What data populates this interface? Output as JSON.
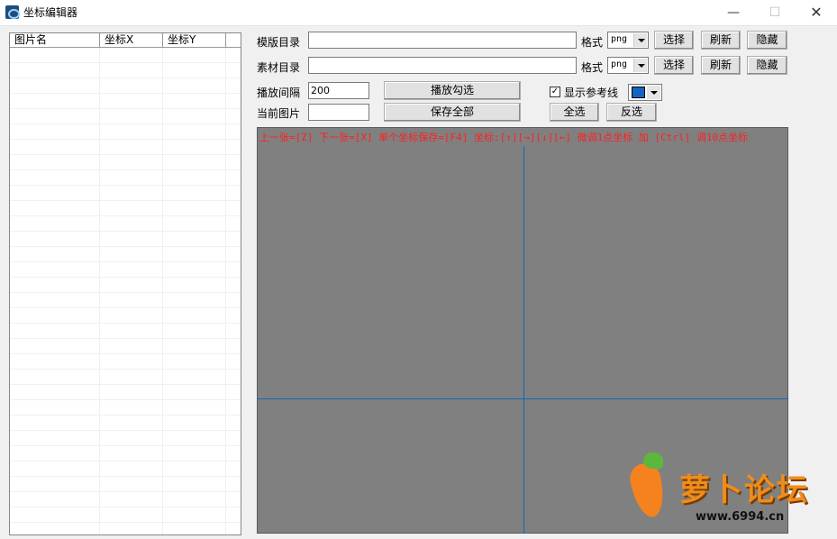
{
  "window": {
    "title": "坐标编辑器",
    "minimize_glyph": "—",
    "maximize_glyph": "☐",
    "close_glyph": "✕"
  },
  "list": {
    "columns": [
      "图片名",
      "坐标X",
      "坐标Y"
    ]
  },
  "template_dir": {
    "label": "模版目录",
    "value": "",
    "format_label": "格式",
    "format_value": "png",
    "select_label": "选择",
    "refresh_label": "刷新",
    "hide_label": "隐藏"
  },
  "material_dir": {
    "label": "素材目录",
    "value": "",
    "format_label": "格式",
    "format_value": "png",
    "select_label": "选择",
    "refresh_label": "刷新",
    "hide_label": "隐藏"
  },
  "playback": {
    "interval_label": "播放间隔",
    "interval_value": "200",
    "play_checked_label": "播放勾选",
    "current_image_label": "当前图片",
    "current_image_value": "",
    "save_all_label": "保存全部"
  },
  "reference": {
    "show_lines_label": "显示参考线",
    "show_lines_checked": true,
    "check_glyph": "✓",
    "line_color": "#1565c0",
    "select_all_label": "全选",
    "invert_label": "反选"
  },
  "canvas": {
    "hint": "上一张=[Z] 下一张=[X] 单个坐标保存=[F4] 坐标:[↑][→][↓][←] 微调1点坐标 加 [Ctrl] 调10点坐标",
    "background": "#808080",
    "hint_color": "#ff2020"
  },
  "watermark": {
    "text": "萝卜论坛",
    "url": "www.6994.cn"
  }
}
